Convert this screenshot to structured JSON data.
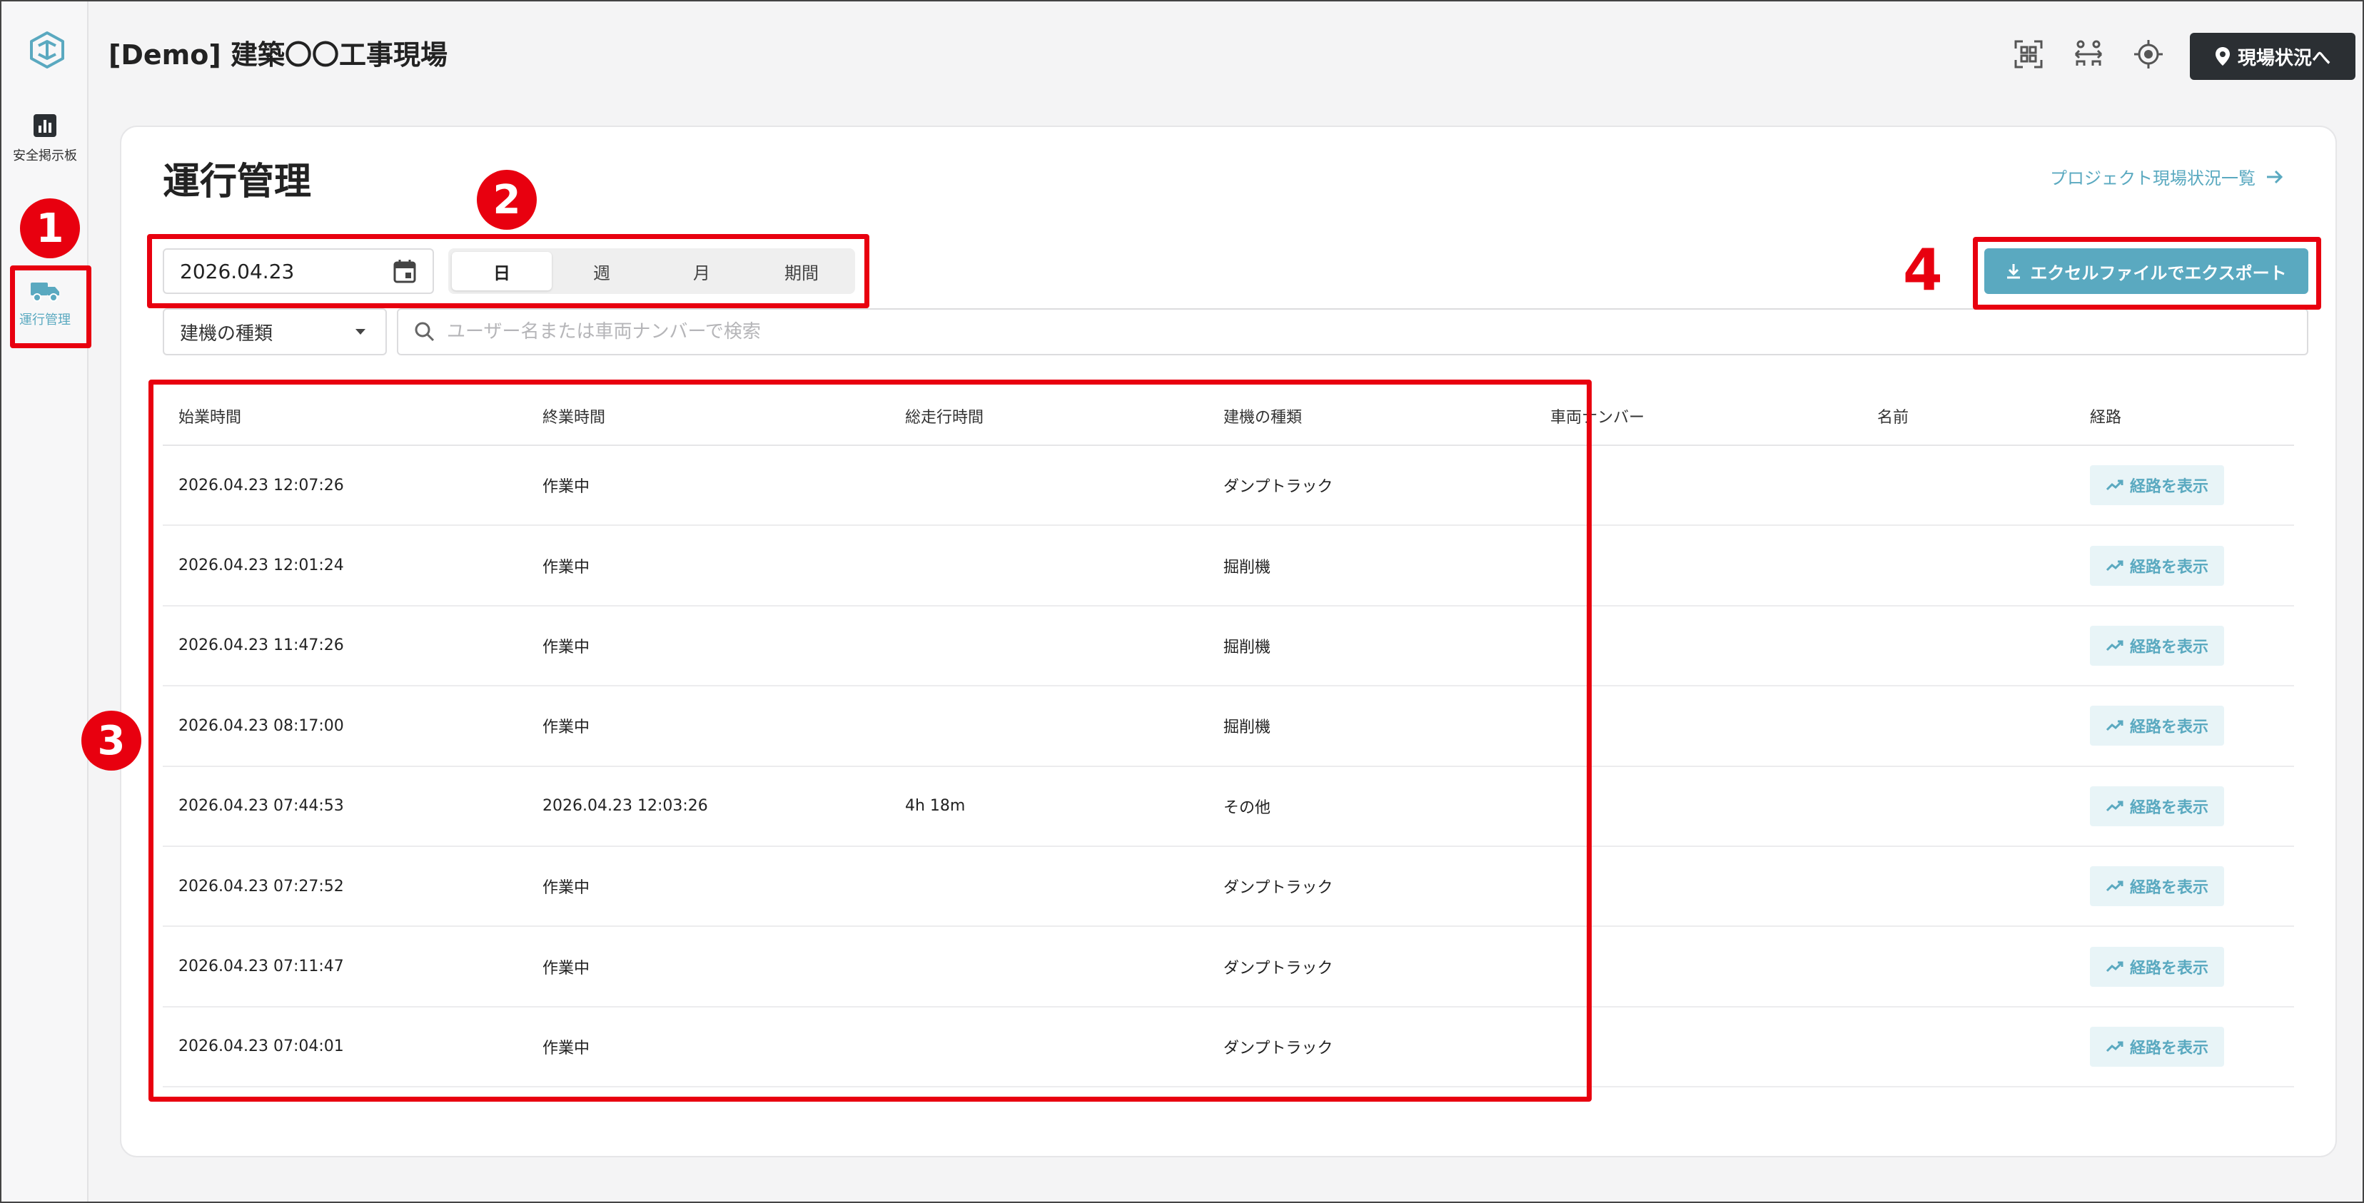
{
  "app": {
    "title": "[Demo] 建築〇〇工事現場",
    "status_button": "現場状況へ"
  },
  "sidebar": {
    "items": [
      {
        "label": "安全掲示板",
        "icon": "bar-chart-icon"
      },
      {
        "label": "運行管理",
        "icon": "truck-icon",
        "active": true
      }
    ]
  },
  "page": {
    "title": "運行管理",
    "project_link": "プロジェクト現場状況一覧"
  },
  "filters": {
    "date": "2026.04.23",
    "periods": [
      "日",
      "週",
      "月",
      "期間"
    ],
    "selected_period": "日",
    "machine_type_label": "建機の種類",
    "search_placeholder": "ユーザー名または車両ナンバーで検索"
  },
  "export": {
    "label": "エクセルファイルでエクスポート"
  },
  "table": {
    "headers": [
      "始業時間",
      "終業時間",
      "総走行時間",
      "建機の種類",
      "車両ナンバー",
      "名前",
      "経路"
    ],
    "route_label": "経路を表示",
    "rows": [
      {
        "start": "2026.04.23 12:07:26",
        "end": "作業中",
        "duration": "",
        "type": "ダンプトラック",
        "vehicle": "",
        "name": ""
      },
      {
        "start": "2026.04.23 12:01:24",
        "end": "作業中",
        "duration": "",
        "type": "掘削機",
        "vehicle": "",
        "name": ""
      },
      {
        "start": "2026.04.23 11:47:26",
        "end": "作業中",
        "duration": "",
        "type": "掘削機",
        "vehicle": "",
        "name": ""
      },
      {
        "start": "2026.04.23 08:17:00",
        "end": "作業中",
        "duration": "",
        "type": "掘削機",
        "vehicle": "",
        "name": ""
      },
      {
        "start": "2026.04.23 07:44:53",
        "end": "2026.04.23 12:03:26",
        "duration": "4h 18m",
        "type": "その他",
        "vehicle": "",
        "name": ""
      },
      {
        "start": "2026.04.23 07:27:52",
        "end": "作業中",
        "duration": "",
        "type": "ダンプトラック",
        "vehicle": "",
        "name": ""
      },
      {
        "start": "2026.04.23 07:11:47",
        "end": "作業中",
        "duration": "",
        "type": "ダンプトラック",
        "vehicle": "",
        "name": ""
      },
      {
        "start": "2026.04.23 07:04:01",
        "end": "作業中",
        "duration": "",
        "type": "ダンプトラック",
        "vehicle": "",
        "name": ""
      }
    ]
  },
  "annotations": [
    "1",
    "2",
    "3",
    "4"
  ],
  "colors": {
    "accent": "#5aa9c0",
    "annotation": "#e8000f",
    "dark_button": "#2b2f33"
  }
}
